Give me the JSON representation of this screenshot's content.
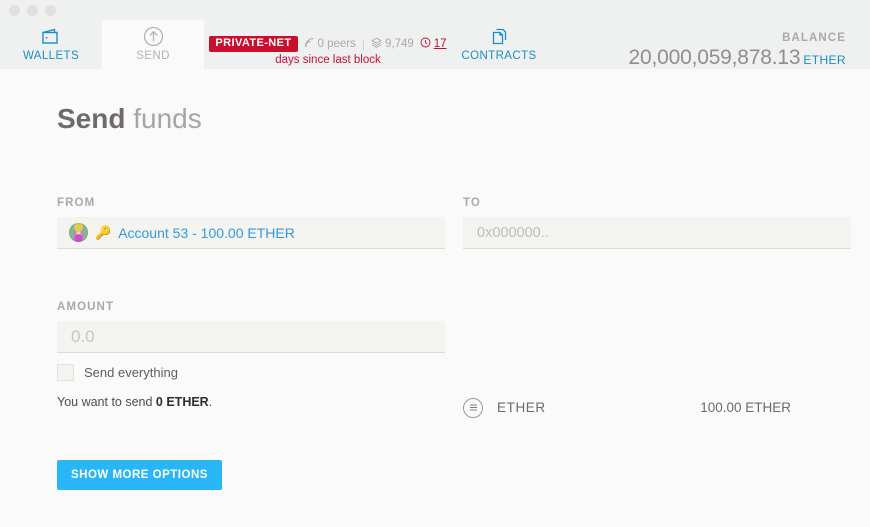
{
  "window": {
    "traffic_lights": [
      "close",
      "minimize",
      "maximize"
    ]
  },
  "header": {
    "tabs": [
      {
        "id": "wallets",
        "label": "WALLETS",
        "icon": "wallet-icon",
        "active": false,
        "color": "#1b8ec4"
      },
      {
        "id": "send",
        "label": "SEND",
        "icon": "up-arrow-circle-icon",
        "active": true,
        "color": "#b6b2b2"
      },
      {
        "id": "contracts",
        "label": "CONTRACTS",
        "icon": "documents-icon",
        "active": false,
        "color": "#1b8ec4"
      }
    ],
    "network": {
      "badge": "PRIVATE-NET",
      "badge_color": "#c8102e",
      "peers_icon": "signal-icon",
      "peers": "0 peers",
      "separator": "|",
      "blocks_icon": "block-icon",
      "blocks": "9,749",
      "time_icon": "clock-icon",
      "time_value": "17",
      "subtitle": "days since last block"
    },
    "balance": {
      "label": "BALANCE",
      "value": "20,000,059,878.13",
      "unit": "ETHER",
      "unit_color": "#1b8ec4"
    }
  },
  "page": {
    "title_bold": "Send",
    "title_light": " funds"
  },
  "form": {
    "from": {
      "label": "FROM",
      "avatar": "identicon",
      "key_icon": "key-icon",
      "account_text": "Account 53 - 100.00 ETHER",
      "account_color": "#3399dd"
    },
    "to": {
      "label": "TO",
      "value": "",
      "placeholder": "0x000000.."
    },
    "amount": {
      "label": "AMOUNT",
      "value": "",
      "placeholder": "0.0",
      "unit_icon": "list-circle-icon",
      "unit_name": "ETHER",
      "unit_available": "100.00 ETHER",
      "send_everything_label": "Send everything",
      "send_everything_checked": false,
      "summary_prefix": "You want to send ",
      "summary_amount": "0 ETHER",
      "summary_suffix": "."
    },
    "show_more_options_label": "SHOW MORE OPTIONS",
    "primary_color": "#29b6f6"
  }
}
